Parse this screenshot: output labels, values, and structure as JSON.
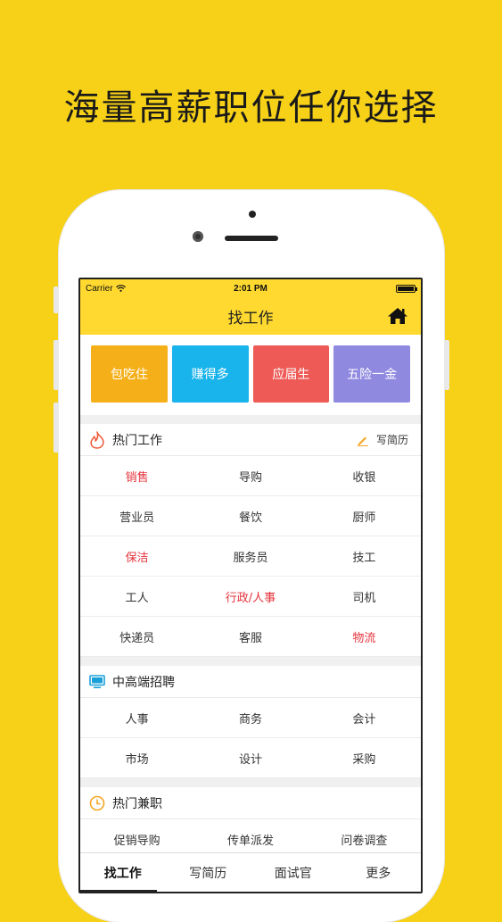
{
  "headline": "海量高薪职位任你选择",
  "status": {
    "carrier": "Carrier",
    "time": "2:01 PM"
  },
  "nav": {
    "title": "找工作",
    "home_icon": "home-icon"
  },
  "tiles": [
    {
      "label": "包吃住",
      "color": "#F5B019"
    },
    {
      "label": "赚得多",
      "color": "#18B4EB"
    },
    {
      "label": "应届生",
      "color": "#EE5A56"
    },
    {
      "label": "五险一金",
      "color": "#8F89DF"
    }
  ],
  "hot_jobs": {
    "title": "热门工作",
    "icon": "flame-icon",
    "action_label": "写简历",
    "action_icon": "pencil-icon",
    "rows": [
      [
        {
          "text": "销售",
          "highlight": true
        },
        {
          "text": "导购",
          "highlight": false
        },
        {
          "text": "收银",
          "highlight": false
        }
      ],
      [
        {
          "text": "营业员",
          "highlight": false
        },
        {
          "text": "餐饮",
          "highlight": false
        },
        {
          "text": "厨师",
          "highlight": false
        }
      ],
      [
        {
          "text": "保洁",
          "highlight": true
        },
        {
          "text": "服务员",
          "highlight": false
        },
        {
          "text": "技工",
          "highlight": false
        }
      ],
      [
        {
          "text": "工人",
          "highlight": false
        },
        {
          "text": "行政/人事",
          "highlight": true
        },
        {
          "text": "司机",
          "highlight": false
        }
      ],
      [
        {
          "text": "快递员",
          "highlight": false
        },
        {
          "text": "客服",
          "highlight": false
        },
        {
          "text": "物流",
          "highlight": true
        }
      ]
    ]
  },
  "senior_jobs": {
    "title": "中高端招聘",
    "icon": "monitor-icon",
    "rows": [
      [
        {
          "text": "人事",
          "highlight": false
        },
        {
          "text": "商务",
          "highlight": false
        },
        {
          "text": "会计",
          "highlight": false
        }
      ],
      [
        {
          "text": "市场",
          "highlight": false
        },
        {
          "text": "设计",
          "highlight": false
        },
        {
          "text": "采购",
          "highlight": false
        }
      ]
    ]
  },
  "part_time": {
    "title": "热门兼职",
    "icon": "clock-icon",
    "rows": [
      [
        {
          "text": "促销导购",
          "highlight": false
        },
        {
          "text": "传单派发",
          "highlight": false
        },
        {
          "text": "问卷调查",
          "highlight": false
        }
      ]
    ]
  },
  "tabbar": [
    {
      "label": "找工作",
      "active": true
    },
    {
      "label": "写简历",
      "active": false
    },
    {
      "label": "面试官",
      "active": false
    },
    {
      "label": "更多",
      "active": false
    }
  ],
  "colors": {
    "background": "#F7D117",
    "topbar": "#FFD92F",
    "highlight": "#E5323B"
  }
}
